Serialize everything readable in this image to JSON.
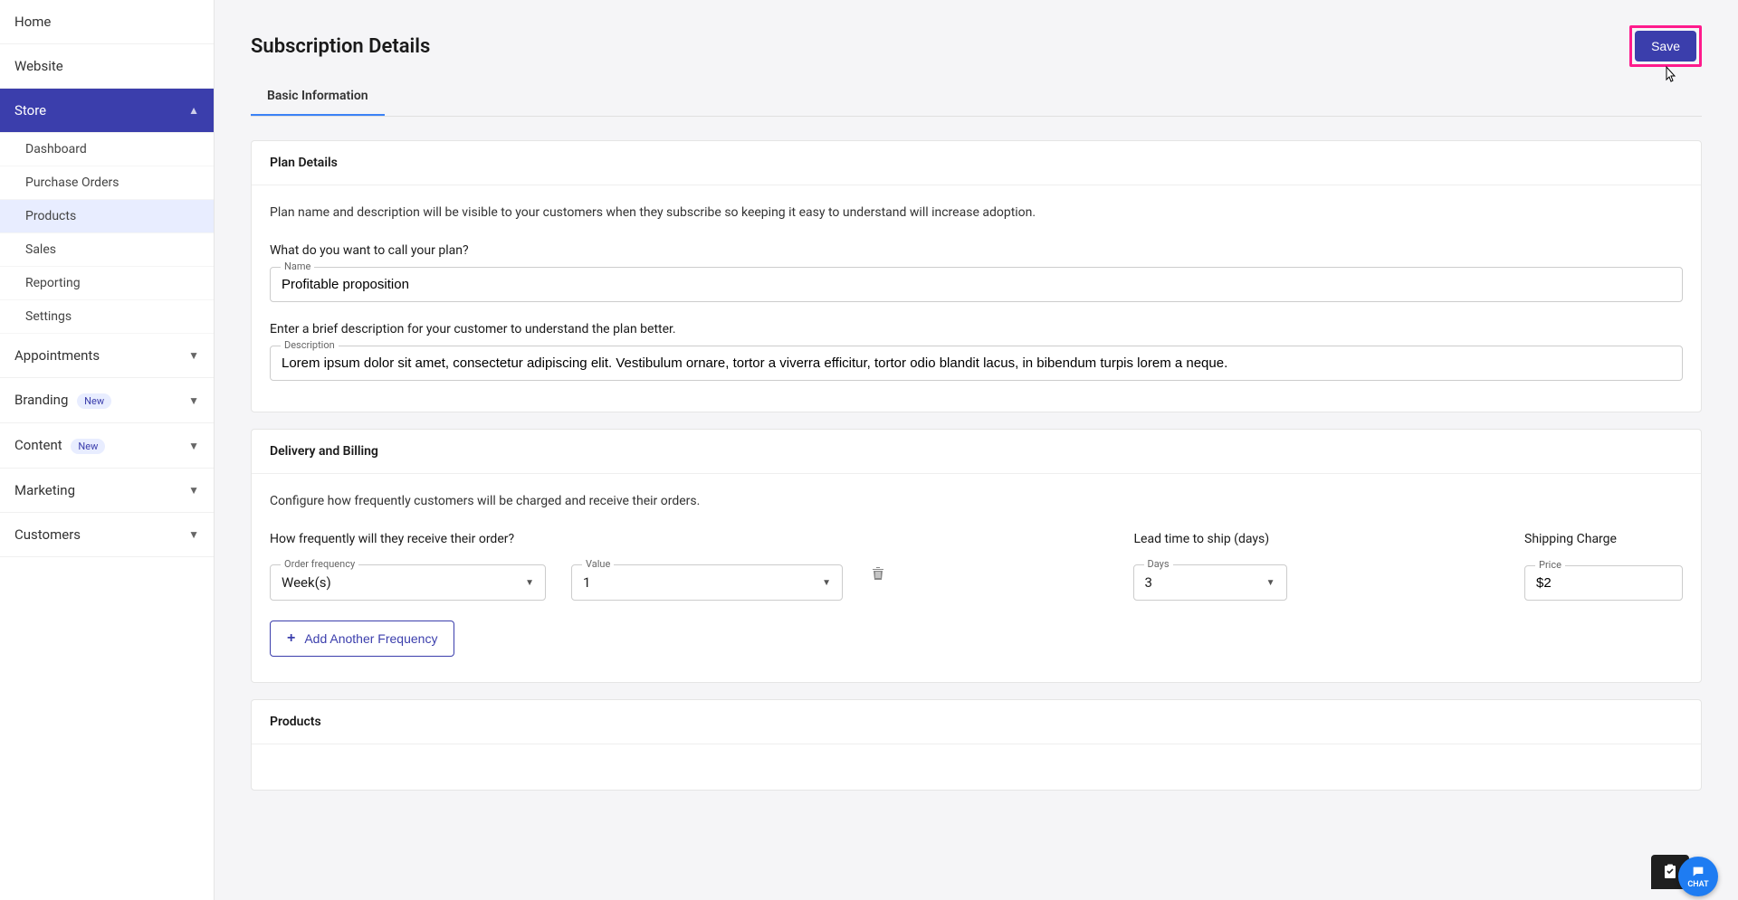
{
  "sidebar": {
    "items": [
      {
        "label": "Home",
        "expandable": false
      },
      {
        "label": "Website",
        "expandable": false
      },
      {
        "label": "Store",
        "expandable": true,
        "active": true
      },
      {
        "label": "Appointments",
        "expandable": true
      },
      {
        "label": "Branding",
        "expandable": true,
        "badge": "New"
      },
      {
        "label": "Content",
        "expandable": true,
        "badge": "New"
      },
      {
        "label": "Marketing",
        "expandable": true
      },
      {
        "label": "Customers",
        "expandable": true
      }
    ],
    "store_sub": [
      "Dashboard",
      "Purchase Orders",
      "Products",
      "Sales",
      "Reporting",
      "Settings"
    ]
  },
  "page": {
    "title": "Subscription Details",
    "save_label": "Save",
    "tab_basic": "Basic Information"
  },
  "plan_details": {
    "header": "Plan Details",
    "intro": "Plan name and description will be visible to your customers when they subscribe so keeping it easy to understand will increase adoption.",
    "name_question": "What do you want to call your plan?",
    "name_label": "Name",
    "name_value": "Profitable proposition",
    "desc_question": "Enter a brief description for your customer to understand the plan better.",
    "desc_label": "Description",
    "desc_value": "Lorem ipsum dolor sit amet, consectetur adipiscing elit. Vestibulum ornare, tortor a viverra efficitur, tortor odio blandit lacus, in bibendum turpis lorem a neque."
  },
  "delivery": {
    "header": "Delivery and Billing",
    "intro": "Configure how frequently customers will be charged and receive their orders.",
    "freq_question": "How frequently will they receive their order?",
    "lead_label": "Lead time to ship (days)",
    "ship_label": "Shipping Charge",
    "order_frequency_label": "Order frequency",
    "order_frequency_value": "Week(s)",
    "value_label": "Value",
    "value_value": "1",
    "days_label": "Days",
    "days_value": "3",
    "price_label": "Price",
    "price_value": "$2",
    "add_another": "Add Another Frequency"
  },
  "products": {
    "header": "Products"
  },
  "chat": {
    "label": "CHAT"
  }
}
